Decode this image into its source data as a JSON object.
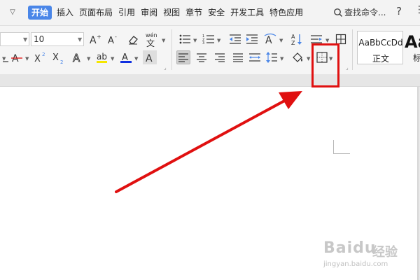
{
  "menubar": {
    "tabs": [
      {
        "label": "开始",
        "active": true
      },
      {
        "label": "插入"
      },
      {
        "label": "页面布局"
      },
      {
        "label": "引用"
      },
      {
        "label": "审阅"
      },
      {
        "label": "视图"
      },
      {
        "label": "章节"
      },
      {
        "label": "安全"
      },
      {
        "label": "开发工具"
      },
      {
        "label": "特色应用"
      }
    ],
    "search_label": "查找命令...",
    "help_label": "?",
    "more_label": "⋮"
  },
  "ribbon": {
    "font_size_value": "10",
    "pinyin_label": "wén",
    "styles": [
      {
        "sample": "AaBbCcDd",
        "name": "正文"
      },
      {
        "sample": "Aa",
        "name": "标"
      }
    ]
  },
  "watermark": {
    "brand": "Baidu",
    "cn": "经验",
    "url": "jingyan.baidu.com"
  },
  "colors": {
    "accent": "#4a86e8",
    "highlight": "#e01010",
    "arrow": "#e01010"
  }
}
